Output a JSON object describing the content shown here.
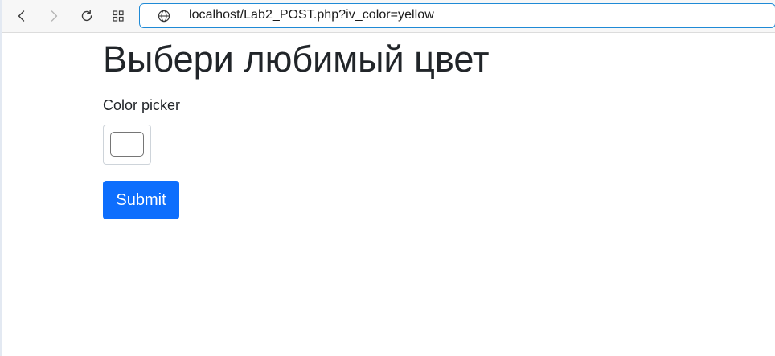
{
  "browser": {
    "url": "localhost/Lab2_POST.php?iv_color=yellow",
    "icons": {
      "back": "chevron-left-icon",
      "forward": "chevron-right-icon",
      "reload": "reload-icon",
      "apps": "grid-icon",
      "site": "globe-icon"
    }
  },
  "page": {
    "title": "Выбери любимый цвет",
    "color_label": "Color picker",
    "color_value": "#ffffff",
    "submit_label": "Submit"
  },
  "colors": {
    "submit_bg": "#0d6efd",
    "text": "#212529",
    "address_border": "#1f8ad6"
  }
}
